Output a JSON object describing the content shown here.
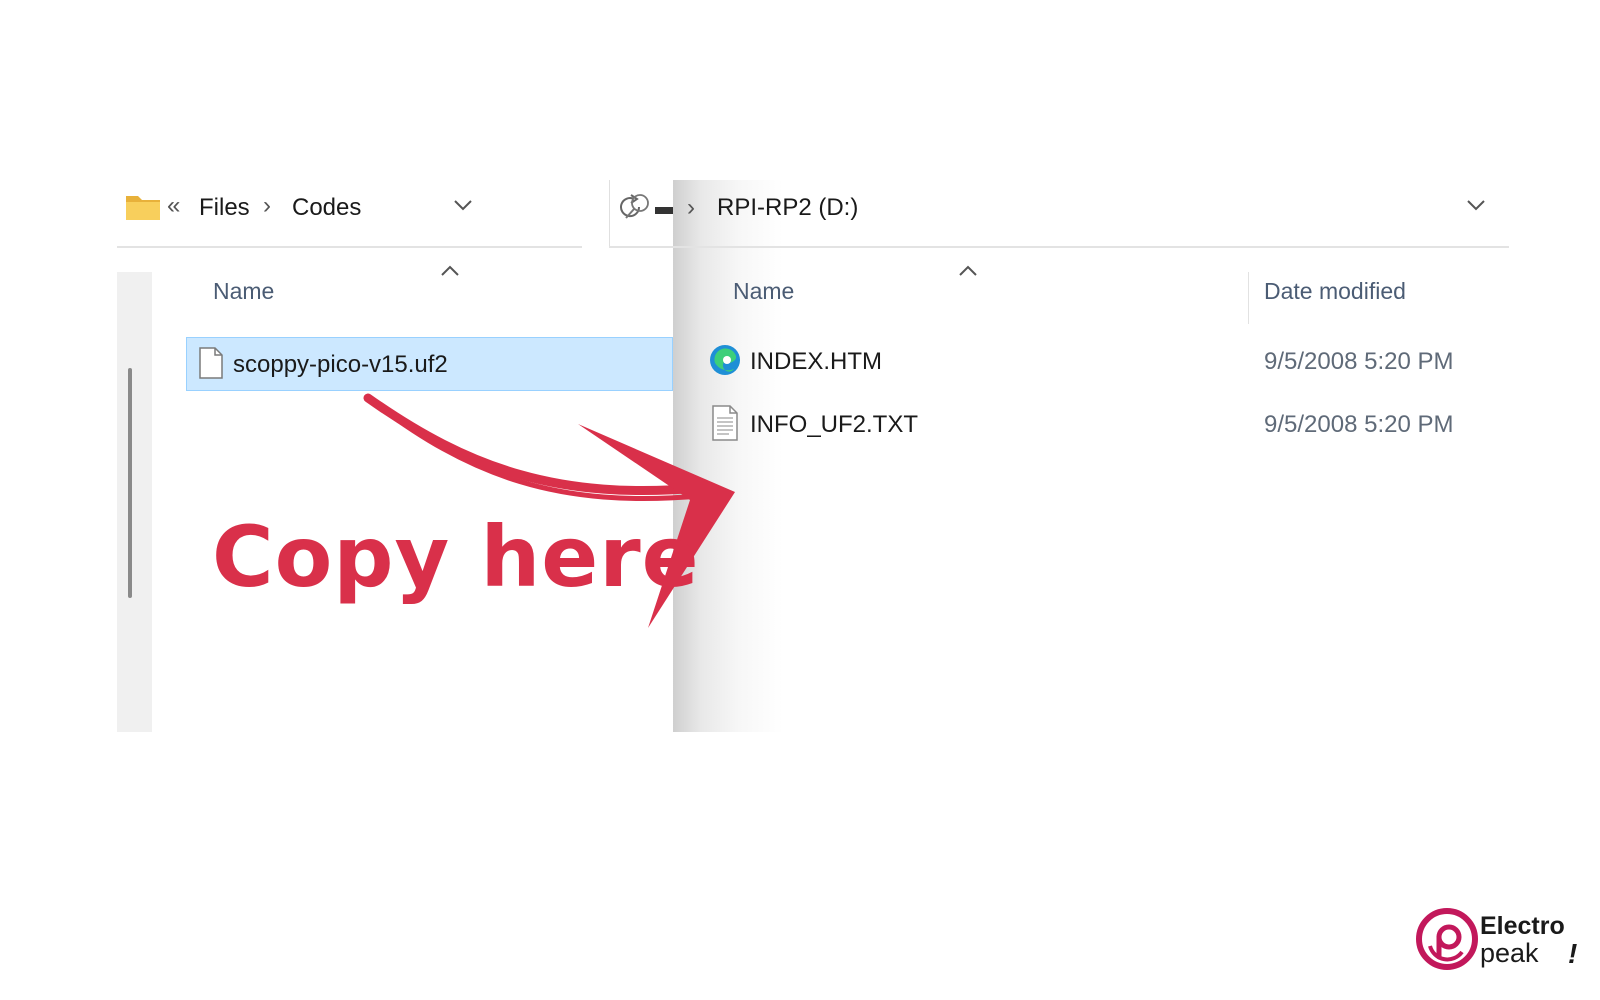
{
  "left_explorer": {
    "breadcrumb": {
      "overflow_glyph": "«",
      "items": [
        "Files",
        "Codes"
      ],
      "separator": "›"
    },
    "column_header": "Name",
    "files": [
      {
        "name": "scoppy-pico-v15.uf2",
        "icon": "blank-file-icon",
        "selected": true
      }
    ]
  },
  "right_explorer": {
    "breadcrumb": {
      "separator": "›",
      "location": "RPI-RP2 (D:)"
    },
    "column_headers": {
      "name": "Name",
      "date": "Date modified"
    },
    "files": [
      {
        "name": "INDEX.HTM",
        "icon": "edge-browser-icon",
        "date": "9/5/2008 5:20 PM"
      },
      {
        "name": "INFO_UF2.TXT",
        "icon": "text-file-icon",
        "date": "9/5/2008 5:20 PM"
      }
    ]
  },
  "annotation": {
    "text": "Copy here",
    "color": "#d9304a"
  },
  "logo": {
    "line1": "Electro",
    "line2": "peak",
    "mark": "!",
    "brand_color": "#c2185b"
  },
  "colors": {
    "selection_bg": "#cce8ff",
    "selection_border": "#99d1ff",
    "header_text": "#4b5c74"
  }
}
